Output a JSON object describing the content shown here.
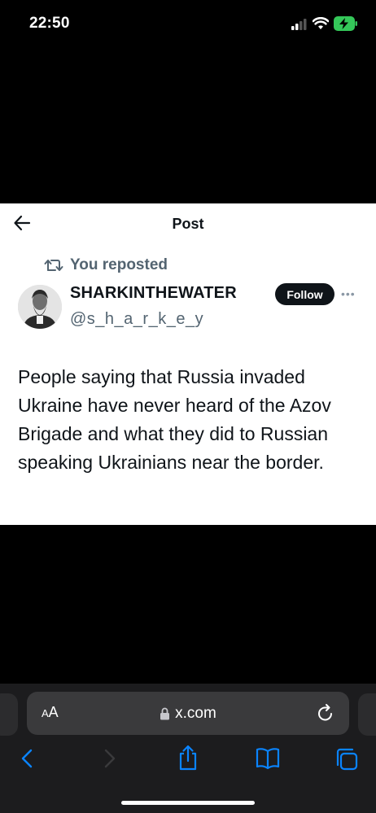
{
  "status_bar": {
    "time": "22:50"
  },
  "post": {
    "header_title": "Post",
    "repost_label": "You reposted",
    "display_name": "SHARKINTHEWATER",
    "handle": "@s_h_a_r_k_e_y",
    "follow_label": "Follow",
    "text": "People saying that Russia invaded Ukraine have never heard of the Azov Brigade and what they did to Russian speaking Ukrainians near the border."
  },
  "browser": {
    "text_size_big": "A",
    "text_size_small": "A",
    "url": "x.com"
  },
  "colors": {
    "accent_blue": "#0a84ff",
    "secondary_text": "#536471",
    "battery_green": "#34c759"
  },
  "icons": [
    "signal-icon",
    "wifi-icon",
    "battery-charging-icon",
    "back-arrow-icon",
    "repost-icon",
    "more-icon",
    "lock-icon",
    "reload-icon",
    "back-icon",
    "forward-icon",
    "share-icon",
    "bookmarks-icon",
    "tabs-icon"
  ]
}
